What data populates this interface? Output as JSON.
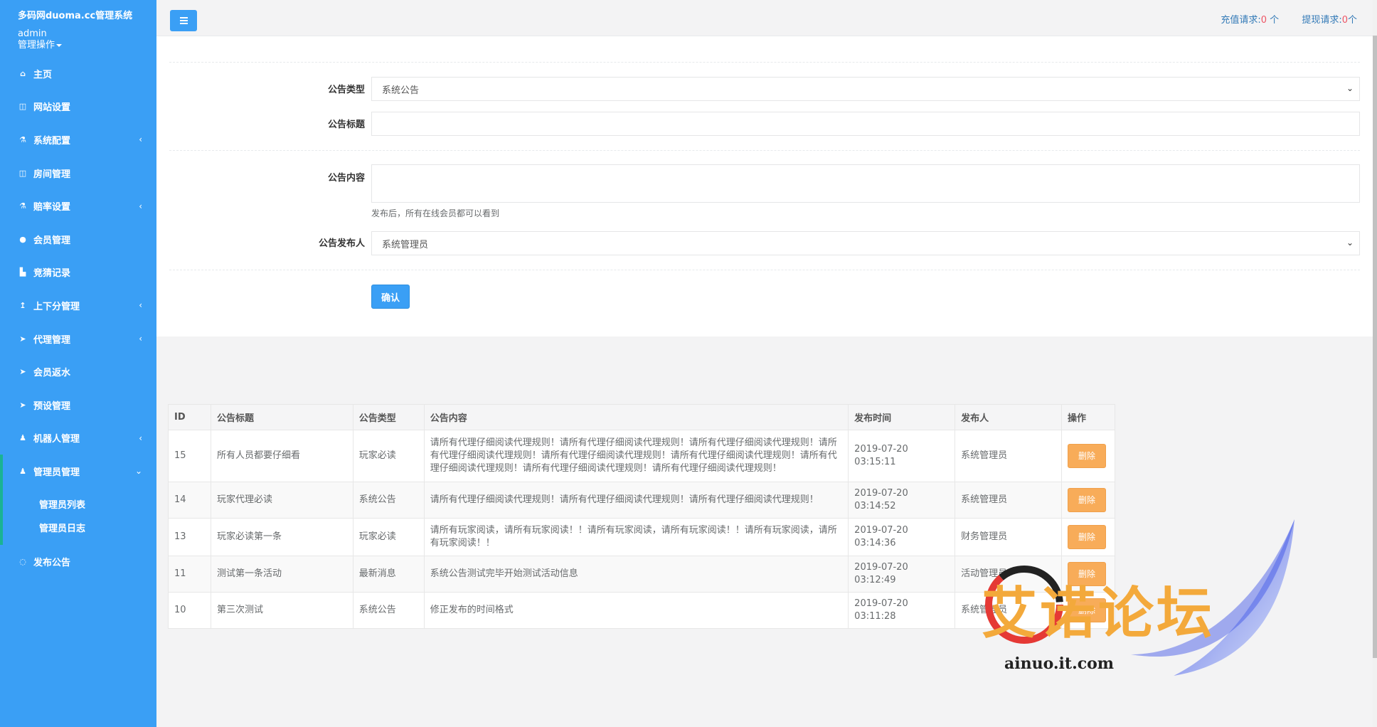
{
  "sidebar": {
    "brand_title": "多码网duoma.cc管理系统",
    "username": "admin",
    "ops_label": "管理操作",
    "items": [
      {
        "label": "主页",
        "icon": "home-icon",
        "glyph": "⌂",
        "arrow": ""
      },
      {
        "label": "网站设置",
        "icon": "columns-icon",
        "glyph": "◫",
        "arrow": ""
      },
      {
        "label": "系统配置",
        "icon": "flask-icon",
        "glyph": "⚗",
        "arrow": "‹"
      },
      {
        "label": "房间管理",
        "icon": "columns-icon",
        "glyph": "◫",
        "arrow": ""
      },
      {
        "label": "赔率设置",
        "icon": "flask-icon",
        "glyph": "⚗",
        "arrow": "‹"
      },
      {
        "label": "会员管理",
        "icon": "user-icon",
        "glyph": "●",
        "arrow": ""
      },
      {
        "label": "竞猜记录",
        "icon": "car-icon",
        "glyph": "▙",
        "arrow": ""
      },
      {
        "label": "上下分管理",
        "icon": "level-up-icon",
        "glyph": "↥",
        "arrow": "‹"
      },
      {
        "label": "代理管理",
        "icon": "paper-plane-icon",
        "glyph": "➤",
        "arrow": "‹"
      },
      {
        "label": "会员返水",
        "icon": "paper-plane-icon",
        "glyph": "➤",
        "arrow": ""
      },
      {
        "label": "预设管理",
        "icon": "paper-plane-icon",
        "glyph": "➤",
        "arrow": ""
      },
      {
        "label": "机器人管理",
        "icon": "male-icon",
        "glyph": "♟",
        "arrow": "‹"
      }
    ],
    "open_item": {
      "label": "管理员管理",
      "icon": "male-icon",
      "glyph": "♟",
      "arrow": "⌄"
    },
    "sub_items": [
      {
        "label": "管理员列表"
      },
      {
        "label": "管理员日志"
      }
    ],
    "last_item": {
      "label": "发布公告",
      "icon": "comment-icon",
      "glyph": "◌"
    }
  },
  "topbar": {
    "recharge_label": "充值请求:",
    "recharge_count": "0",
    "recharge_unit": " 个",
    "withdraw_label": "提现请求:",
    "withdraw_count": "0",
    "withdraw_unit": "个"
  },
  "form": {
    "type_label": "公告类型",
    "type_value": "系统公告",
    "title_label": "公告标题",
    "title_value": "",
    "content_label": "公告内容",
    "content_value": "",
    "content_help": "发布后，所有在线会员都可以看到",
    "publisher_label": "公告发布人",
    "publisher_value": "系统管理员",
    "confirm_label": "确认"
  },
  "table": {
    "headers": {
      "id": "ID",
      "title": "公告标题",
      "type": "公告类型",
      "content": "公告内容",
      "time": "发布时间",
      "publisher": "发布人",
      "action": "操作"
    },
    "rows": [
      {
        "id": "15",
        "title": "所有人员都要仔细看",
        "type": "玩家必读",
        "content": "请所有代理仔细阅读代理规则！请所有代理仔细阅读代理规则！请所有代理仔细阅读代理规则！请所有代理仔细阅读代理规则！请所有代理仔细阅读代理规则！请所有代理仔细阅读代理规则！请所有代理仔细阅读代理规则！请所有代理仔细阅读代理规则！请所有代理仔细阅读代理规则！",
        "time": "2019-07-20 03:15:11",
        "publisher": "系统管理员",
        "action": "删除"
      },
      {
        "id": "14",
        "title": "玩家代理必读",
        "type": "系统公告",
        "content": "请所有代理仔细阅读代理规则！请所有代理仔细阅读代理规则！请所有代理仔细阅读代理规则！",
        "time": "2019-07-20 03:14:52",
        "publisher": "系统管理员",
        "action": "删除"
      },
      {
        "id": "13",
        "title": "玩家必读第一条",
        "type": "玩家必读",
        "content": "请所有玩家阅读，请所有玩家阅读！！请所有玩家阅读，请所有玩家阅读！！请所有玩家阅读，请所有玩家阅读！！",
        "time": "2019-07-20 03:14:36",
        "publisher": "财务管理员",
        "action": "删除"
      },
      {
        "id": "11",
        "title": "测试第一条活动",
        "type": "最新消息",
        "content": "系统公告测试完毕开始测试活动信息",
        "time": "2019-07-20 03:12:49",
        "publisher": "活动管理员",
        "action": "删除"
      },
      {
        "id": "10",
        "title": "第三次测试",
        "type": "系统公告",
        "content": "修正发布的时间格式",
        "time": "2019-07-20 03:11:28",
        "publisher": "系统管理员",
        "action": "删除"
      }
    ]
  },
  "watermark": {
    "text": "艾诺论坛",
    "url": "ainuo.it.com"
  }
}
